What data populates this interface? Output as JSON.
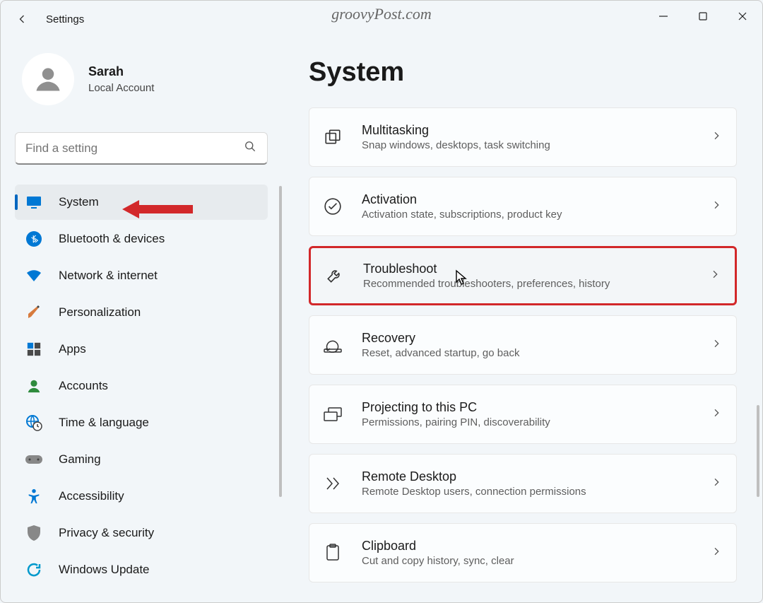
{
  "titlebar": {
    "title": "Settings"
  },
  "watermark": "groovyPost.com",
  "profile": {
    "name": "Sarah",
    "account_type": "Local Account"
  },
  "search": {
    "placeholder": "Find a setting"
  },
  "sidebar": {
    "items": [
      {
        "label": "System",
        "icon": "monitor",
        "selected": true
      },
      {
        "label": "Bluetooth & devices",
        "icon": "bluetooth"
      },
      {
        "label": "Network & internet",
        "icon": "wifi"
      },
      {
        "label": "Personalization",
        "icon": "brush"
      },
      {
        "label": "Apps",
        "icon": "apps"
      },
      {
        "label": "Accounts",
        "icon": "person"
      },
      {
        "label": "Time & language",
        "icon": "globe-clock"
      },
      {
        "label": "Gaming",
        "icon": "gamepad"
      },
      {
        "label": "Accessibility",
        "icon": "accessibility"
      },
      {
        "label": "Privacy & security",
        "icon": "shield"
      },
      {
        "label": "Windows Update",
        "icon": "update"
      }
    ]
  },
  "page": {
    "heading": "System",
    "cards": [
      {
        "title": "Multitasking",
        "desc": "Snap windows, desktops, task switching",
        "icon": "multitasking"
      },
      {
        "title": "Activation",
        "desc": "Activation state, subscriptions, product key",
        "icon": "check-circle"
      },
      {
        "title": "Troubleshoot",
        "desc": "Recommended troubleshooters, preferences, history",
        "icon": "wrench",
        "highlight": true
      },
      {
        "title": "Recovery",
        "desc": "Reset, advanced startup, go back",
        "icon": "recovery"
      },
      {
        "title": "Projecting to this PC",
        "desc": "Permissions, pairing PIN, discoverability",
        "icon": "project"
      },
      {
        "title": "Remote Desktop",
        "desc": "Remote Desktop users, connection permissions",
        "icon": "remote"
      },
      {
        "title": "Clipboard",
        "desc": "Cut and copy history, sync, clear",
        "icon": "clipboard"
      }
    ]
  },
  "annotations": {
    "arrow_color": "#d2282a",
    "highlight_color": "#d2282a"
  }
}
